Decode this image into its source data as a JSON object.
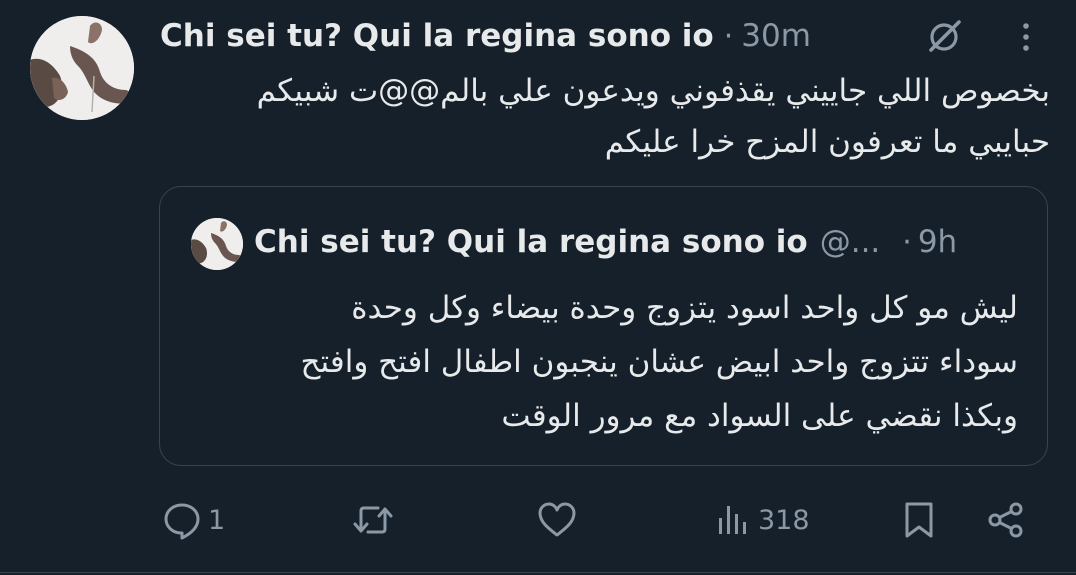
{
  "tweet": {
    "author_name": "Chi sei tu? Qui la regina sono io",
    "separator": "·",
    "timestamp": "30m",
    "text_lines": [
      "بخصوص اللي جاييني يقذفوني ويدعون علي بالم@@ت شبيكم",
      "حبايبي ما تعرفون المزح خرا عليكم"
    ]
  },
  "quoted_tweet": {
    "author_name": "Chi sei tu? Qui la regina sono io",
    "handle": "@...",
    "separator": "·",
    "timestamp": "9h",
    "text_lines": [
      "ليش مو كل واحد اسود يتزوج وحدة بيضاء وكل وحدة",
      "سوداء تتزوج واحد ابيض عشان ينجبون اطفال افتح وافتح",
      "وبكذا نقضي على السواد مع مرور الوقت"
    ]
  },
  "actions": {
    "reply_count": "1",
    "views_count": "318"
  },
  "icons": {
    "grok": "grok-icon",
    "more": "more-icon",
    "reply": "reply-icon",
    "retweet": "retweet-icon",
    "like": "like-icon",
    "views": "views-icon",
    "bookmark": "bookmark-icon",
    "share": "share-icon"
  },
  "colors": {
    "background": "#15202b",
    "primary_text": "#e7e9ea",
    "secondary_text": "#8b98a5",
    "border": "#38444d"
  }
}
